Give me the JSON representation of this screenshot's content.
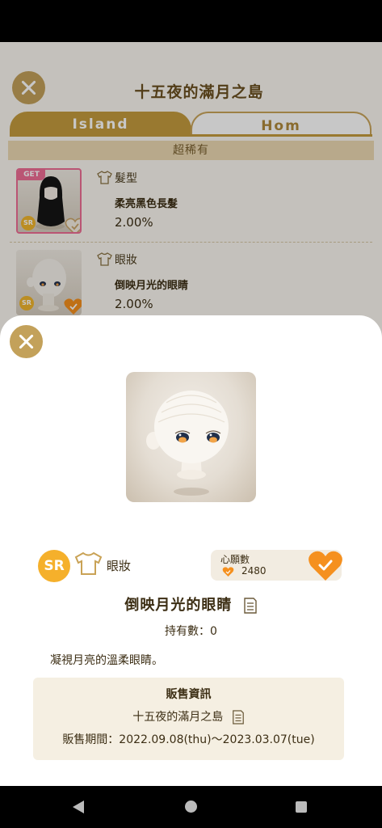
{
  "background": {
    "title": "十五夜的滿月之島",
    "tabs": [
      {
        "label": "Island",
        "active": true
      },
      {
        "label": "Hom",
        "active": false
      }
    ],
    "rarity_header": "超稀有",
    "items": [
      {
        "badge": "GET",
        "rarity": "SR",
        "category": "髮型",
        "name": "柔亮黑色長髮",
        "rate": "2.00%",
        "wishlisted": false
      },
      {
        "badge": "",
        "rarity": "SR",
        "category": "眼妝",
        "name": "倒映月光的眼睛",
        "rate": "2.00%",
        "wishlisted": true
      }
    ]
  },
  "detail": {
    "rarity": "SR",
    "category": "眼妝",
    "wish_label": "心願數",
    "wish_count": "2480",
    "wishlisted": true,
    "name": "倒映月光的眼睛",
    "owned": "持有數：0",
    "description": "凝視月亮的溫柔眼睛。",
    "sale": {
      "title": "販售資訊",
      "island": "十五夜的滿月之島",
      "period": "販售期間：2022.09.08(thu)〜2023.03.07(tue)"
    }
  },
  "colors": {
    "gold": "#c59b3e",
    "heart_orange": "#f5901e",
    "sr_yellow": "#f5b02b",
    "get_pink": "#ef6e95"
  },
  "icons": {
    "close": "close-icon",
    "shirt": "shirt-icon",
    "heart": "heart-check-icon",
    "document": "document-icon"
  }
}
